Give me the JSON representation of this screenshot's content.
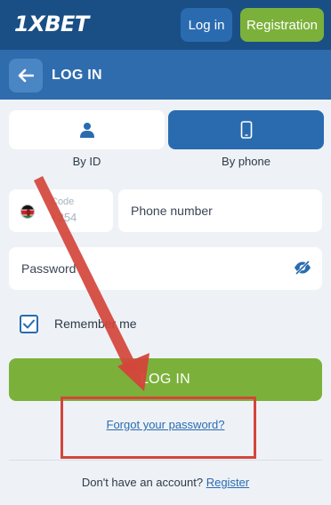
{
  "header": {
    "logo": "1XBET",
    "login_label": "Log in",
    "registration_label": "Registration"
  },
  "subheader": {
    "title": "LOG IN"
  },
  "tabs": [
    {
      "label": "By ID",
      "icon": "person-icon",
      "active": false
    },
    {
      "label": "By phone",
      "icon": "mobile-phone-icon",
      "active": true
    }
  ],
  "form": {
    "country_flag": "kenya-flag-icon",
    "code_label": "Code",
    "code_value": "+254",
    "phone_placeholder": "Phone number",
    "password_placeholder": "Password",
    "password_toggle_icon": "eye-slash-icon",
    "remember_label": "Remember me",
    "remember_checked": true,
    "submit_label": "LOG IN",
    "forgot_label": "Forgot your password?"
  },
  "footer": {
    "no_account_text": "Don't have an account?",
    "register_label": "Register"
  },
  "colors": {
    "header_bg": "#1a4f86",
    "subheader_bg": "#2f6cae",
    "accent_blue": "#2a6bb0",
    "accent_green": "#7bb13a",
    "annotation_red": "#d4453b"
  }
}
